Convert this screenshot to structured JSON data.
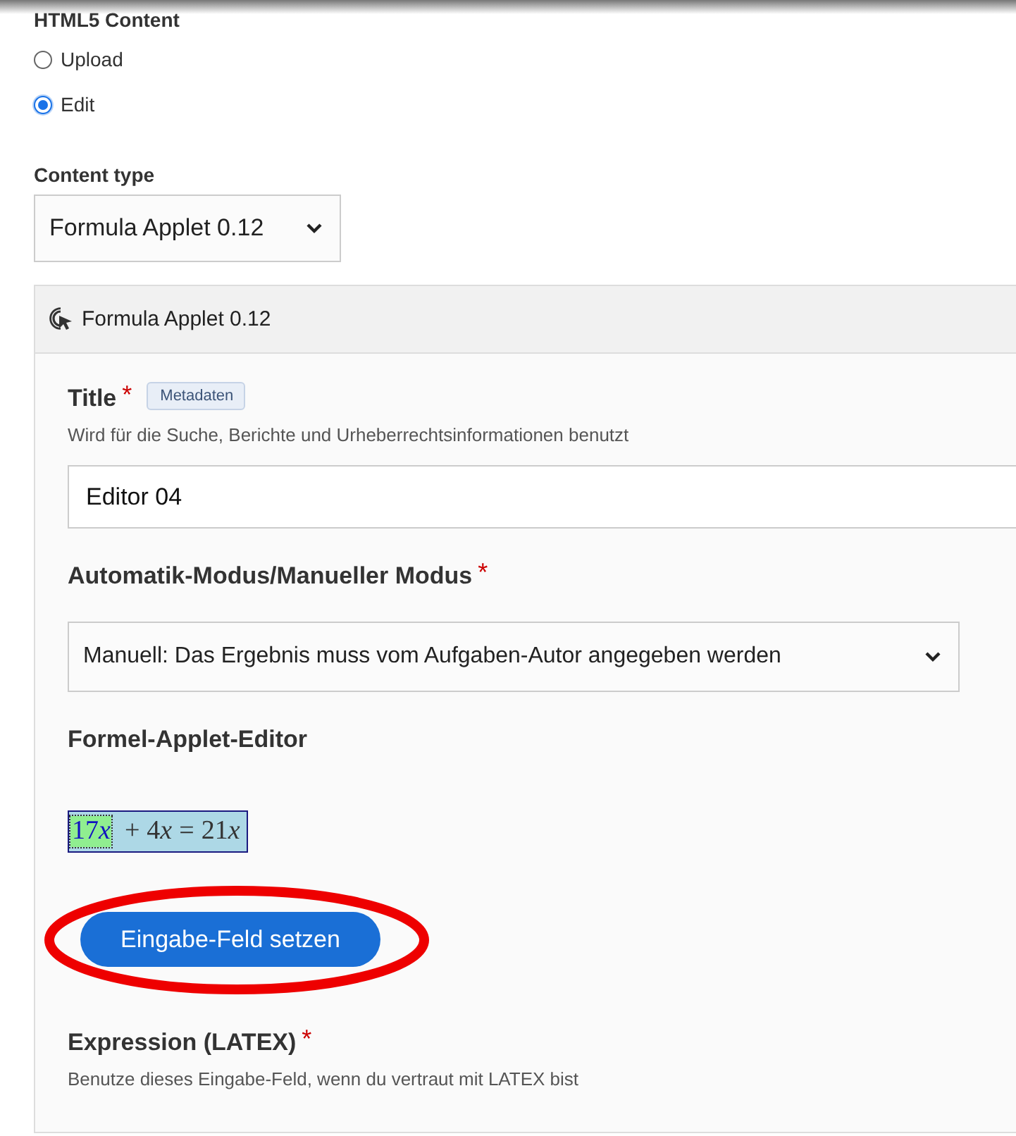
{
  "html5_content": {
    "label": "HTML5 Content",
    "options": [
      {
        "label": "Upload",
        "selected": false
      },
      {
        "label": "Edit",
        "selected": true
      }
    ]
  },
  "content_type": {
    "label": "Content type",
    "value": "Formula Applet 0.12"
  },
  "panel": {
    "title": "Formula Applet 0.12",
    "title_field": {
      "label": "Title",
      "required_mark": "*",
      "tag": "Metadaten",
      "description": "Wird für die Suche, Berichte und Urheberrechtsinformationen benutzt",
      "value": "Editor 04"
    },
    "mode_field": {
      "label": "Automatik-Modus/Manueller Modus",
      "required_mark": "*",
      "value": "Manuell: Das Ergebnis muss vom Aufgaben-Autor angegeben werden"
    },
    "editor": {
      "label": "Formel-Applet-Editor",
      "formula": [
        {
          "selected": true,
          "tokens": [
            {
              "text": "17",
              "kind": "number"
            },
            {
              "text": "x",
              "kind": "variable"
            }
          ]
        },
        {
          "selected": false,
          "tokens": [
            {
              "text": "+",
              "kind": "operator"
            },
            {
              "text": "4",
              "kind": "number"
            },
            {
              "text": "x",
              "kind": "variable"
            },
            {
              "text": "=",
              "kind": "operator"
            },
            {
              "text": "21",
              "kind": "number"
            },
            {
              "text": "x",
              "kind": "variable"
            }
          ]
        }
      ],
      "button": {
        "label": "Eingabe-Feld setzen",
        "circled": true
      }
    },
    "expression_field": {
      "label": "Expression (LATEX)",
      "required_mark": "*",
      "description": "Benutze dieses Eingabe-Feld, wenn du vertraut mit LATEX bist"
    }
  }
}
